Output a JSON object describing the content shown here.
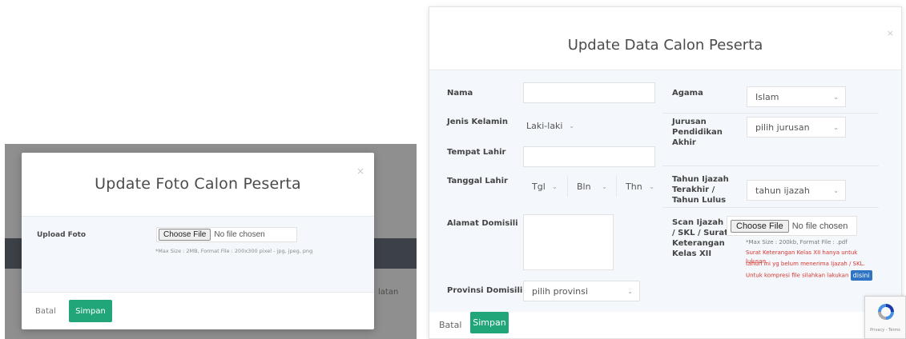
{
  "left_modal": {
    "title": "Update Foto Calon Peserta",
    "close": "×",
    "upload_label": "Upload Foto",
    "file_button": "Choose File",
    "file_status": "No file chosen",
    "hint": "*Max Size : 2MB, Format File : 200x300 pixel - jpg, jpeg, png",
    "cancel_label": "Batal",
    "save_label": "Simpan",
    "background_text": "latan"
  },
  "right_modal": {
    "title": "Update Data Calon Peserta",
    "close": "×",
    "fields": {
      "nama": {
        "label": "Nama"
      },
      "agama": {
        "label": "Agama",
        "value": "Islam"
      },
      "jenis_kelamin": {
        "label": "Jenis Kelamin",
        "value": "Laki-laki"
      },
      "jurusan": {
        "label": "Jurusan Pendidikan Akhir",
        "value": "pilih jurusan"
      },
      "tempat_lahir": {
        "label": "Tempat Lahir"
      },
      "tanggal_lahir": {
        "label": "Tanggal Lahir",
        "day": "Tgl",
        "month": "Bln",
        "year": "Thn"
      },
      "tahun_ijazah": {
        "label": "Tahun Ijazah Terakhir / Tahun Lulus",
        "value": "tahun ijazah"
      },
      "alamat": {
        "label": "Alamat Domisili"
      },
      "scan_ijazah": {
        "label": "Scan Ijazah / SKL / Surat Keterangan Kelas XII",
        "file_button": "Choose File",
        "file_status": "No file chosen",
        "hint": "*Max Size : 200kb, Format File : .pdf",
        "note_line1": "Surat Keterangan Kelas XII hanya untuk lulusan",
        "note_line2": "tahun ini yg belum menerima Ijazah / SKL.",
        "note_line3": "Untuk kompresi file silahkan lakukan",
        "note_link": "disini"
      },
      "provinsi": {
        "label": "Provinsi Domisili",
        "value": "pilih provinsi"
      }
    },
    "cancel_label": "Batal",
    "save_label": "Simpan"
  },
  "recaptcha": {
    "text": "Privacy - Terms"
  },
  "colors": {
    "primary_green": "#21a67a",
    "link_blue": "#2f73c4",
    "warning_red": "#d9342b"
  },
  "icons": {
    "close": "close-icon",
    "dropdown": "chevron-down-icon",
    "recaptcha": "recaptcha-logo-icon"
  }
}
